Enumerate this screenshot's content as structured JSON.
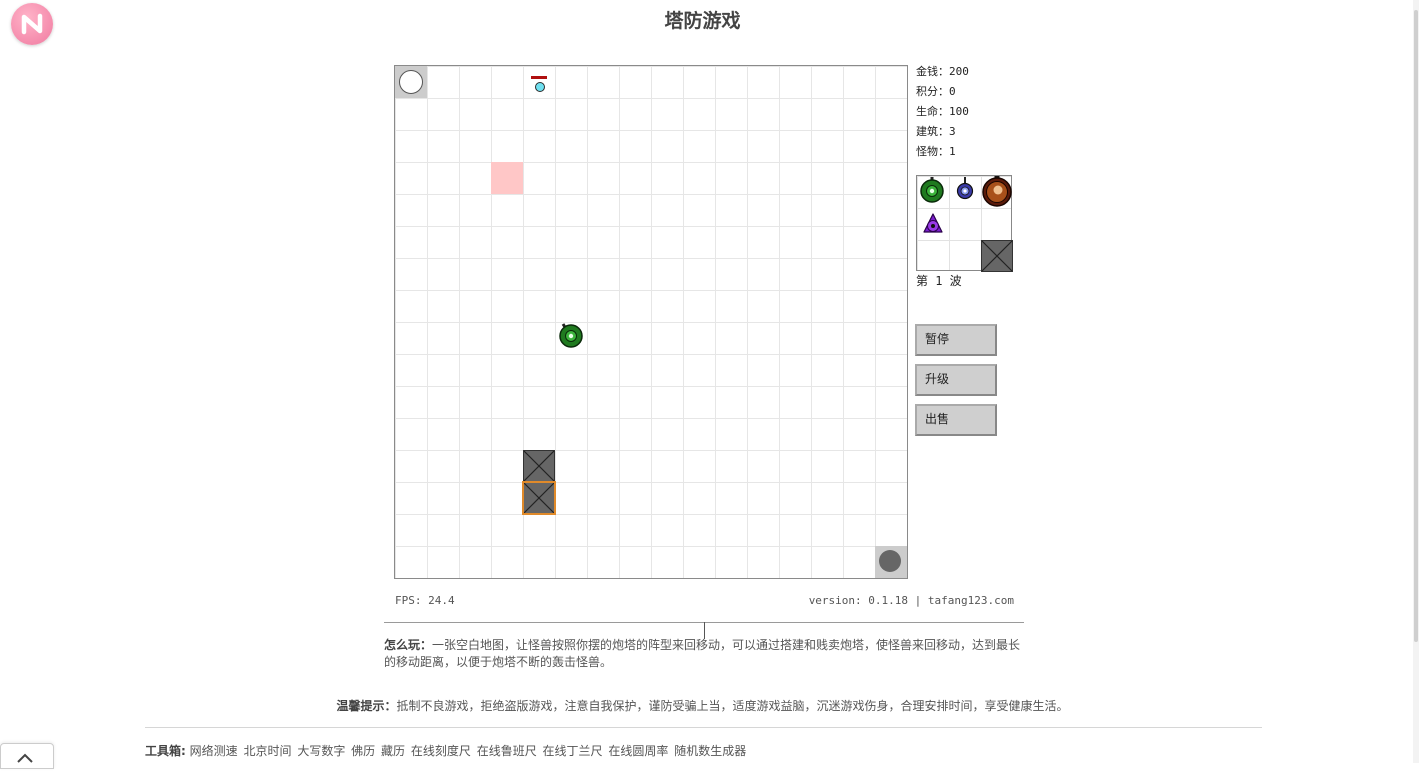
{
  "page": {
    "title": "塔防游戏"
  },
  "stats": [
    {
      "label": "金钱：",
      "value": "200"
    },
    {
      "label": "积分：",
      "value": "0"
    },
    {
      "label": "生命：",
      "value": "100"
    },
    {
      "label": "建筑：",
      "value": "3"
    },
    {
      "label": "怪物：",
      "value": "1"
    }
  ],
  "shop": {
    "items": [
      "green-cannon-icon",
      "blue-laser-icon",
      "orange-heavy-cannon-icon",
      "purple-tower-icon",
      "wall-block-icon"
    ]
  },
  "wave": "第 1 波",
  "buttons": {
    "pause": "暂停",
    "upgrade": "升级",
    "sell": "出售"
  },
  "footer": {
    "fps": "FPS: 24.4",
    "version": "version: 0.1.18 | tafang123.com"
  },
  "howto": {
    "label": "怎么玩：",
    "text": "一张空白地图，让怪兽按照你摆的炮塔的阵型来回移动，可以通过搭建和贱卖炮塔，使怪兽来回移动，达到最长的移动距离，以便于炮塔不断的轰击怪兽。"
  },
  "tips": {
    "label": "温馨提示：",
    "text": "抵制不良游戏，拒绝盗版游戏，注意自我保护，谨防受骗上当，适度游戏益脑，沉迷游戏伤身，合理安排时间，享受健康生活。"
  },
  "toolbox": {
    "label": "工具箱:",
    "links": [
      "网络测速",
      "北京时间",
      "大写数字",
      "佛历",
      "藏历",
      "在线刻度尺",
      "在线鲁班尺",
      "在线丁兰尺",
      "在线圆周率",
      "随机数生成器"
    ]
  },
  "colors": {
    "hover_cell": "#ffc7c7",
    "monster_hp": "#b01010",
    "monster_body": "#6fe0f0",
    "selected_outline": "#e08a2a",
    "green_tower": "#1f7a1f",
    "blue_tower": "#3a3aa8",
    "orange_tower": "#a8501a",
    "purple_tower": "#7a1ed0"
  }
}
